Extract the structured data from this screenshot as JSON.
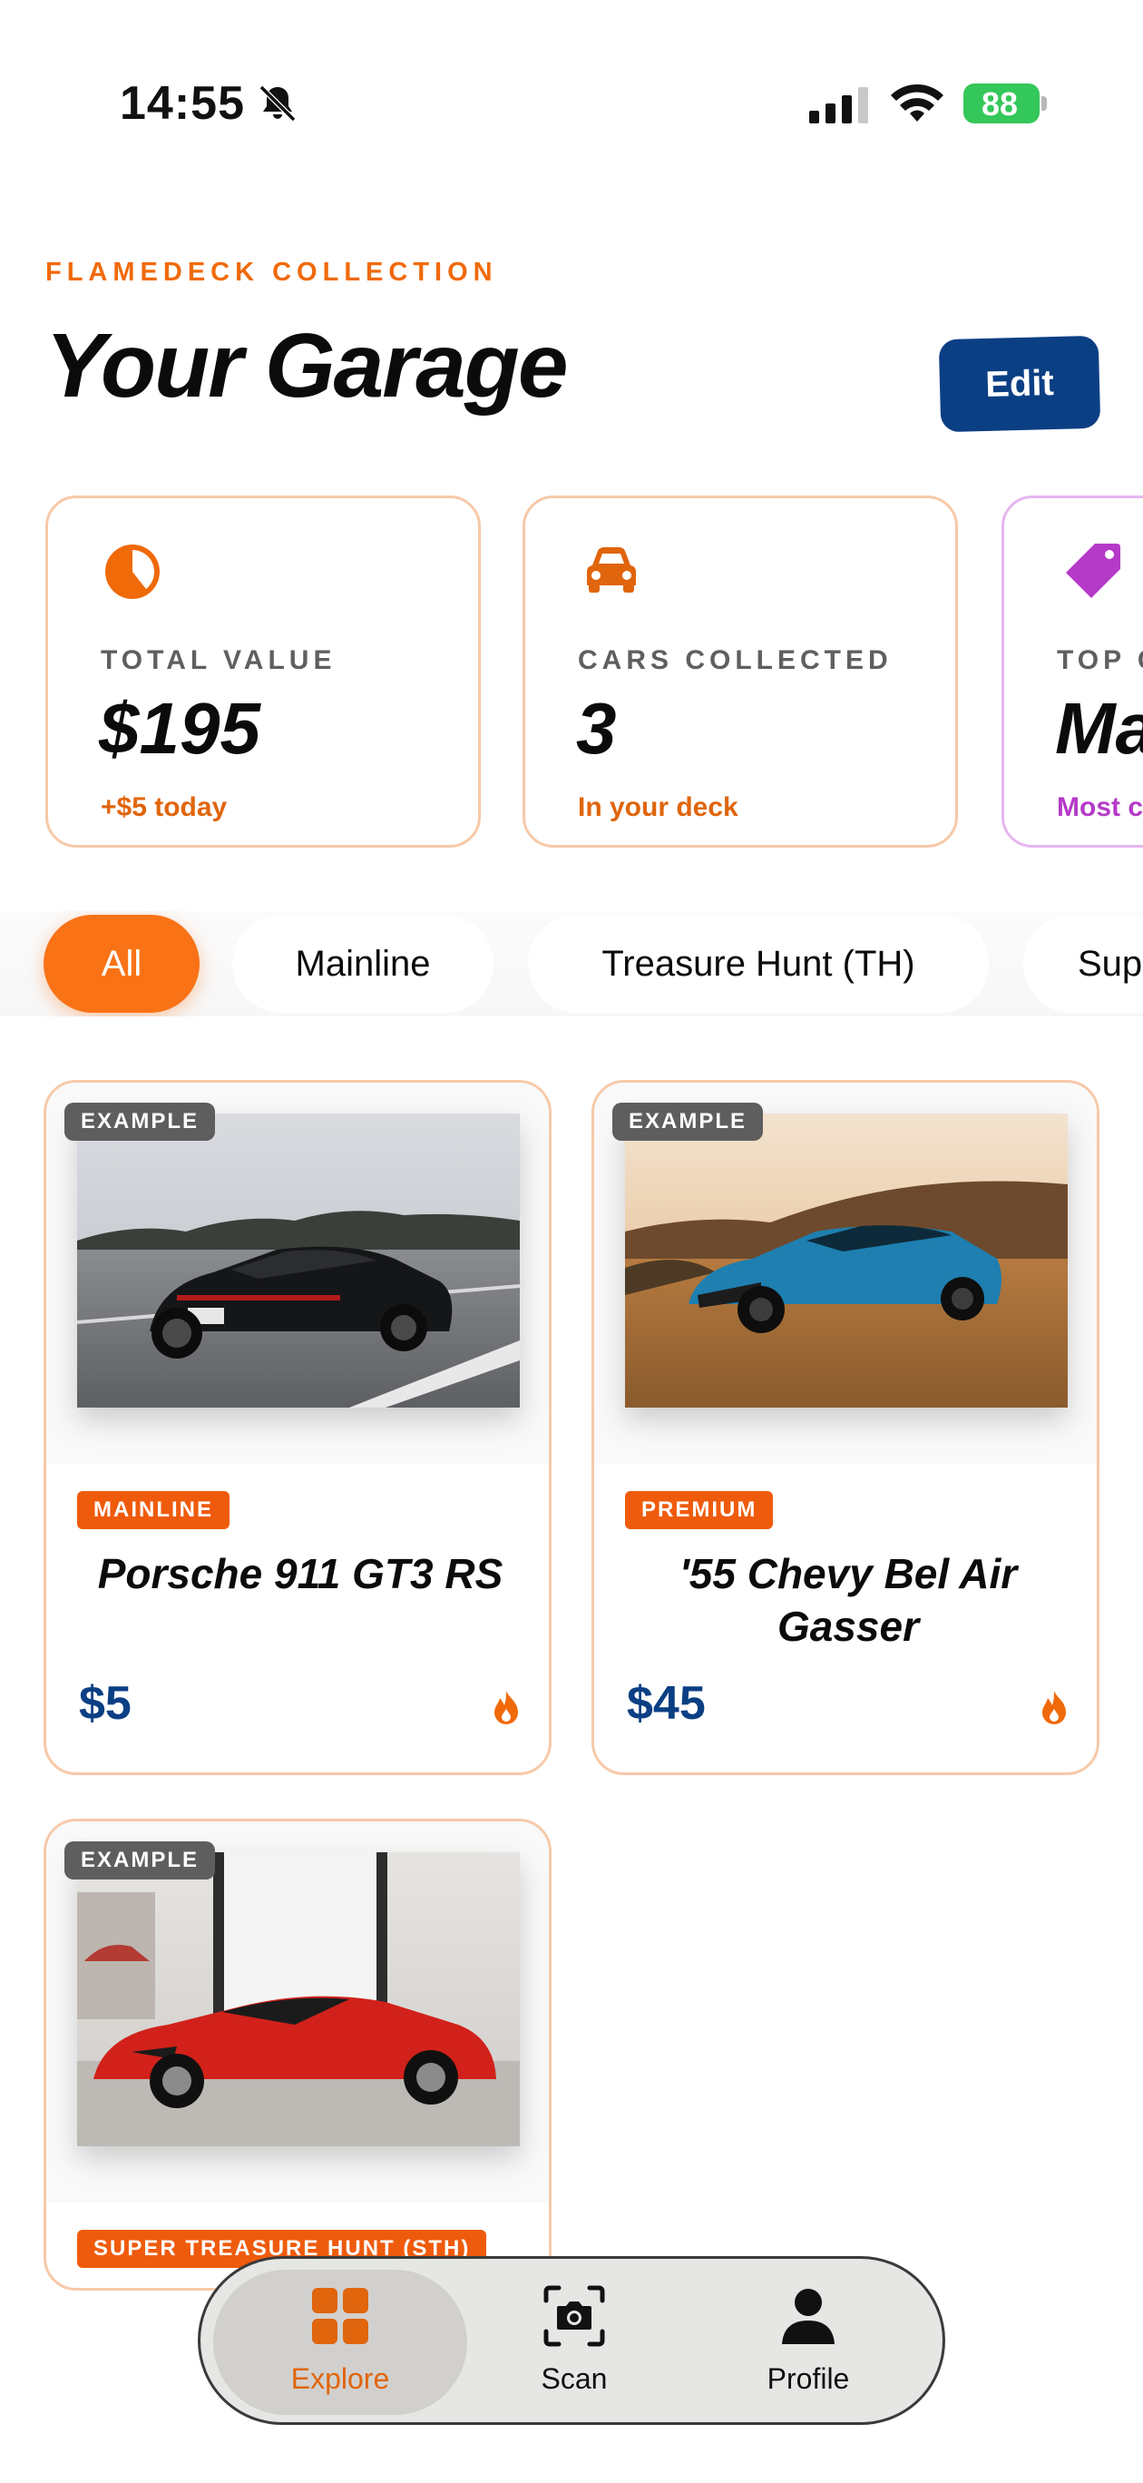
{
  "status_bar": {
    "time": "14:55",
    "battery_level": "88"
  },
  "header": {
    "eyebrow": "FLAMEDECK COLLECTION",
    "title": "Your Garage",
    "edit_label": "Edit"
  },
  "stats": [
    {
      "icon": "pie-chart-icon",
      "label": "TOTAL VALUE",
      "value": "$195",
      "sub": "+$5 today"
    },
    {
      "icon": "car-icon",
      "label": "CARS COLLECTED",
      "value": "3",
      "sub": "In your deck"
    },
    {
      "icon": "tag-icon",
      "label": "TOP C",
      "value": "Ma",
      "sub": "Most c"
    }
  ],
  "filters": [
    "All",
    "Mainline",
    "Treasure Hunt (TH)",
    "Sup"
  ],
  "cards": [
    {
      "badge": "EXAMPLE",
      "tier": "MAINLINE",
      "name": "Porsche 911 GT3 RS",
      "price": "$5"
    },
    {
      "badge": "EXAMPLE",
      "tier": "PREMIUM",
      "name": "'55 Chevy Bel Air Gasser",
      "price": "$45"
    },
    {
      "badge": "EXAMPLE",
      "tier": "SUPER TREASURE HUNT (STH)",
      "name": "",
      "price": ""
    }
  ],
  "tabbar": {
    "explore": "Explore",
    "scan": "Scan",
    "profile": "Profile"
  },
  "colors": {
    "accent": "#f97316",
    "accent_text": "#e0650d",
    "navy": "#0b3f84",
    "card_border": "#f7c9a8",
    "purple": "#b53ac8",
    "battery_green": "#34c759"
  }
}
